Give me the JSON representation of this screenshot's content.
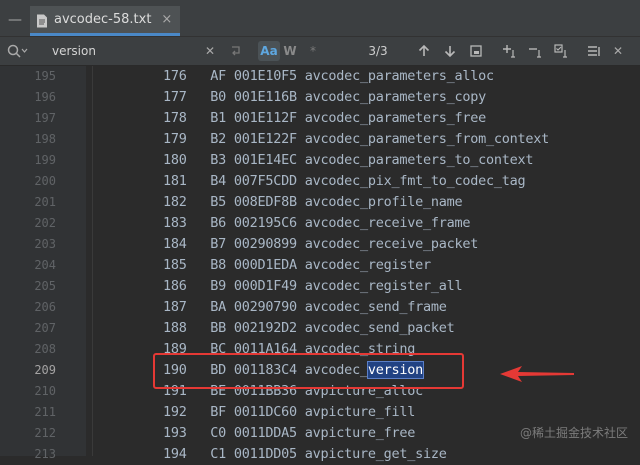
{
  "tab": {
    "filename": "avcodec-58.txt",
    "close_glyph": "×"
  },
  "search": {
    "query": "version",
    "match_count": "3/3",
    "case_label": "Aa",
    "word_label": "W",
    "regex_label": "*"
  },
  "lines": [
    {
      "ln": "195",
      "text": "176   AF 001E10F5 avcodec_parameters_alloc"
    },
    {
      "ln": "196",
      "text": "177   B0 001E116B avcodec_parameters_copy"
    },
    {
      "ln": "197",
      "text": "178   B1 001E112F avcodec_parameters_free"
    },
    {
      "ln": "198",
      "text": "179   B2 001E122F avcodec_parameters_from_context"
    },
    {
      "ln": "199",
      "text": "180   B3 001E14EC avcodec_parameters_to_context"
    },
    {
      "ln": "200",
      "text": "181   B4 007F5CDD avcodec_pix_fmt_to_codec_tag"
    },
    {
      "ln": "201",
      "text": "182   B5 008EDF8B avcodec_profile_name"
    },
    {
      "ln": "202",
      "text": "183   B6 002195C6 avcodec_receive_frame"
    },
    {
      "ln": "203",
      "text": "184   B7 00290899 avcodec_receive_packet"
    },
    {
      "ln": "204",
      "text": "185   B8 000D1EDA avcodec_register"
    },
    {
      "ln": "205",
      "text": "186   B9 000D1F49 avcodec_register_all"
    },
    {
      "ln": "206",
      "text": "187   BA 00290790 avcodec_send_frame"
    },
    {
      "ln": "207",
      "text": "188   BB 002192D2 avcodec_send_packet"
    },
    {
      "ln": "208",
      "text": "189   BC 0011A164 avcodec_string"
    },
    {
      "ln": "209",
      "prefix": "190   BD 001183C4 avcodec_",
      "match": "version"
    },
    {
      "ln": "210",
      "text": "191   BE 0011BB36 avpicture_alloc"
    },
    {
      "ln": "211",
      "text": "192   BF 0011DC60 avpicture_fill"
    },
    {
      "ln": "212",
      "text": "193   C0 0011DDA5 avpicture_free"
    },
    {
      "ln": "213",
      "text": "194   C1 0011DD05 avpicture_get_size"
    }
  ],
  "watermark": "@稀土掘金技术社区",
  "colors": {
    "annotation": "#e53935",
    "match_bg": "#214283",
    "tab_underline": "#4a88c7"
  }
}
